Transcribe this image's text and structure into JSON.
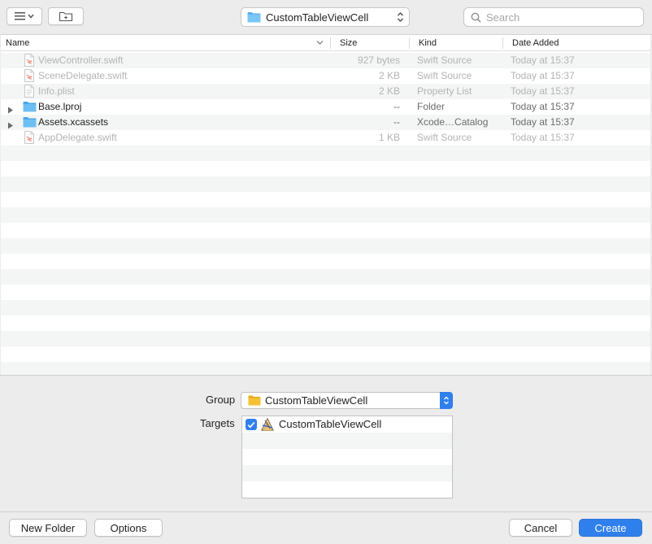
{
  "toolbar": {
    "view_icon": "list-view-icon",
    "new_folder_icon": "new-folder-icon",
    "location": "CustomTableViewCell",
    "search_placeholder": "Search"
  },
  "columns": {
    "name": "Name",
    "size": "Size",
    "kind": "Kind",
    "date_added": "Date Added"
  },
  "files": [
    {
      "name": "ViewController.swift",
      "size": "927 bytes",
      "kind": "Swift Source",
      "date": "Today at 15:37",
      "type": "swift",
      "enabled": false,
      "expandable": false
    },
    {
      "name": "SceneDelegate.swift",
      "size": "2 KB",
      "kind": "Swift Source",
      "date": "Today at 15:37",
      "type": "swift",
      "enabled": false,
      "expandable": false
    },
    {
      "name": "Info.plist",
      "size": "2 KB",
      "kind": "Property List",
      "date": "Today at 15:37",
      "type": "plist",
      "enabled": false,
      "expandable": false
    },
    {
      "name": "Base.lproj",
      "size": "--",
      "kind": "Folder",
      "date": "Today at 15:37",
      "type": "folder",
      "enabled": true,
      "expandable": true
    },
    {
      "name": "Assets.xcassets",
      "size": "--",
      "kind": "Xcode…Catalog",
      "date": "Today at 15:37",
      "type": "folder",
      "enabled": true,
      "expandable": true
    },
    {
      "name": "AppDelegate.swift",
      "size": "1 KB",
      "kind": "Swift Source",
      "date": "Today at 15:37",
      "type": "swift",
      "enabled": false,
      "expandable": false
    }
  ],
  "options": {
    "group_label": "Group",
    "group_value": "CustomTableViewCell",
    "targets_label": "Targets",
    "targets": [
      {
        "name": "CustomTableViewCell",
        "checked": true
      }
    ]
  },
  "footer": {
    "new_folder": "New Folder",
    "options": "Options",
    "cancel": "Cancel",
    "create": "Create"
  },
  "colors": {
    "accent": "#2f80ed",
    "folder": "#5ab4f0",
    "group_folder": "#f5c033"
  }
}
